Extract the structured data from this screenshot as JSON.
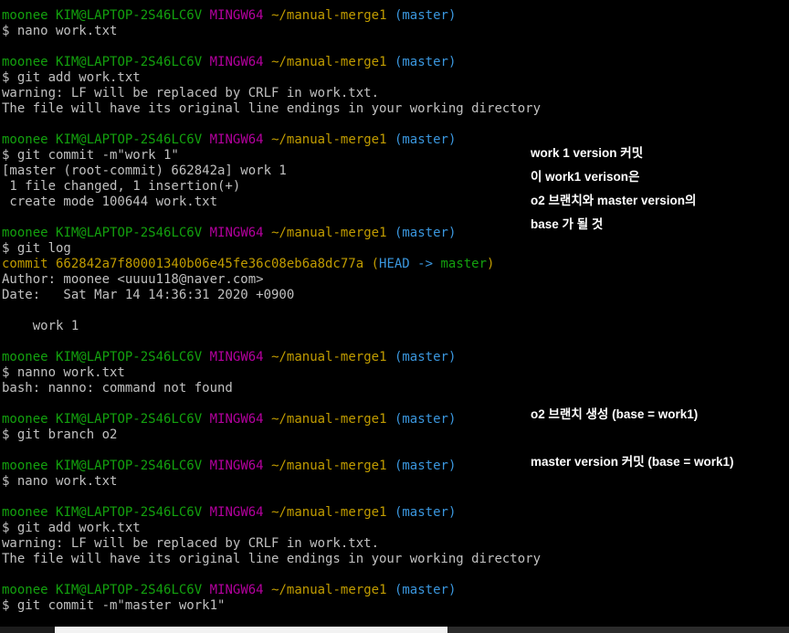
{
  "prompt": {
    "user": "moonee",
    "host": "KIM@LAPTOP-2S46LC6V",
    "system": "MINGW64",
    "path": "~/manual-merge1",
    "branch": "(master)"
  },
  "lines": [
    {
      "type": "prompt"
    },
    {
      "type": "text",
      "text": "$ nano work.txt"
    },
    {
      "type": "blank"
    },
    {
      "type": "prompt"
    },
    {
      "type": "text",
      "text": "$ git add work.txt"
    },
    {
      "type": "text",
      "text": "warning: LF will be replaced by CRLF in work.txt."
    },
    {
      "type": "text",
      "text": "The file will have its original line endings in your working directory"
    },
    {
      "type": "blank"
    },
    {
      "type": "prompt"
    },
    {
      "type": "text",
      "text": "$ git commit -m\"work 1\""
    },
    {
      "type": "text",
      "text": "[master (root-commit) 662842a] work 1"
    },
    {
      "type": "text",
      "text": " 1 file changed, 1 insertion(+)"
    },
    {
      "type": "text",
      "text": " create mode 100644 work.txt"
    },
    {
      "type": "blank"
    },
    {
      "type": "prompt"
    },
    {
      "type": "text",
      "text": "$ git log"
    },
    {
      "type": "commit",
      "hash": "commit 662842a7f80001340b06e45fe36c08eb6a8dc77a",
      "head": "HEAD",
      "arrow": "->",
      "ref": "master"
    },
    {
      "type": "text",
      "text": "Author: moonee <uuuu118@naver.com>"
    },
    {
      "type": "text",
      "text": "Date:   Sat Mar 14 14:36:31 2020 +0900"
    },
    {
      "type": "blank"
    },
    {
      "type": "text",
      "text": "    work 1"
    },
    {
      "type": "blank"
    },
    {
      "type": "prompt"
    },
    {
      "type": "text",
      "text": "$ nanno work.txt"
    },
    {
      "type": "text",
      "text": "bash: nanno: command not found"
    },
    {
      "type": "blank"
    },
    {
      "type": "prompt"
    },
    {
      "type": "text",
      "text": "$ git branch o2"
    },
    {
      "type": "blank"
    },
    {
      "type": "prompt"
    },
    {
      "type": "text",
      "text": "$ nano work.txt"
    },
    {
      "type": "blank"
    },
    {
      "type": "prompt"
    },
    {
      "type": "text",
      "text": "$ git add work.txt"
    },
    {
      "type": "text",
      "text": "warning: LF will be replaced by CRLF in work.txt."
    },
    {
      "type": "text",
      "text": "The file will have its original line endings in your working directory"
    },
    {
      "type": "blank"
    },
    {
      "type": "prompt"
    },
    {
      "type": "text",
      "text": "$ git commit -m\"master work1\""
    }
  ],
  "annotations": {
    "note1": "work 1 version 커밋",
    "note2": "이 work1 verison은",
    "note3": "o2 브랜치와 master version의",
    "note4": "base 가 될 것",
    "note5": "o2 브랜치 생성 (base = work1)",
    "note6": "master version 커밋 (base = work1)"
  },
  "colors": {
    "background": "#000000",
    "text": "#c0c0c0",
    "user_host": "#13a10e",
    "system": "#b4009e",
    "path": "#c19c00",
    "branch": "#3a96dd"
  }
}
